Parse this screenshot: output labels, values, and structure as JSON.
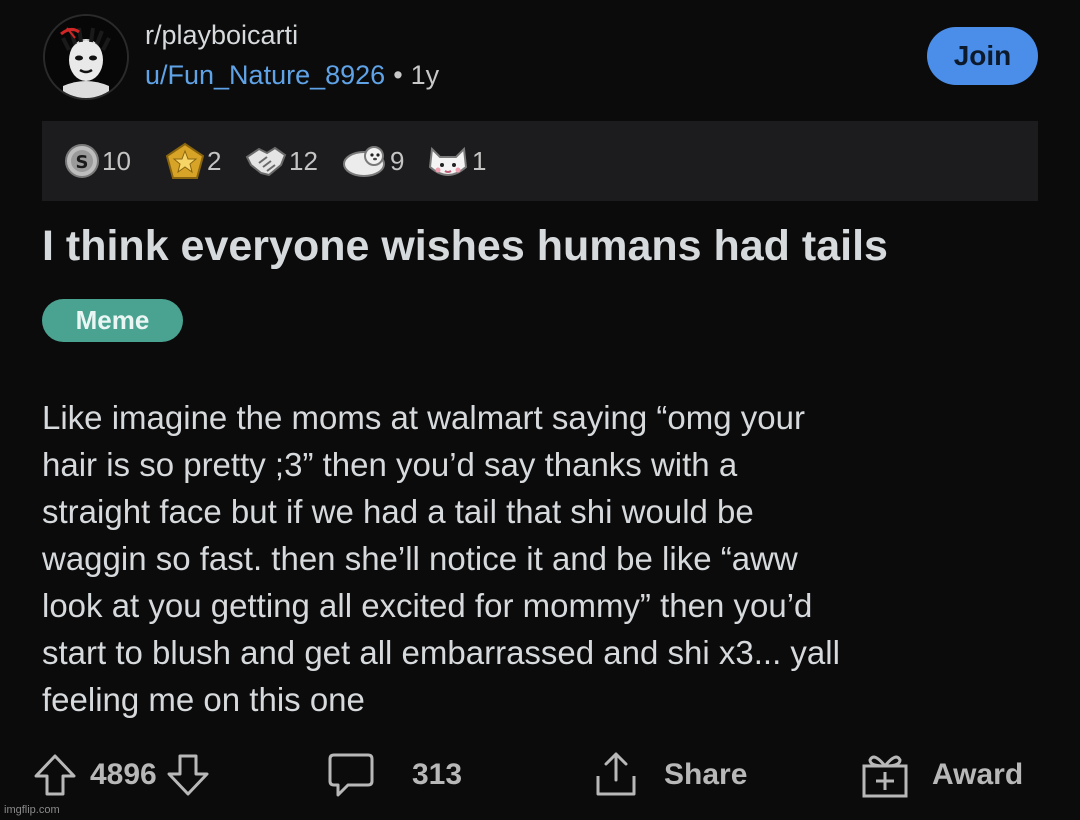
{
  "post": {
    "subreddit": "r/playboicarti",
    "username": "u/Fun_Nature_8926",
    "separator": "•",
    "age": "1y",
    "join_label": "Join",
    "title": "I think everyone wishes humans had tails",
    "flair": "Meme",
    "body_lines": [
      "Like imagine the moms at walmart saying “omg your",
      "hair is so pretty ;3” then you’d say thanks with a",
      "straight face but if we had a tail that shi would be",
      "waggin so fast. then she’ll notice it and be like “aww",
      "look at you getting all excited for mommy” then you’d",
      "start to blush and get all embarrassed and shi x3... yall",
      "feeling me on this one"
    ]
  },
  "awards": [
    {
      "icon": "silver-coin-icon",
      "count": "10"
    },
    {
      "icon": "gold-star-icon",
      "count": "2"
    },
    {
      "icon": "handshake-icon",
      "count": "12"
    },
    {
      "icon": "seal-icon",
      "count": "9"
    },
    {
      "icon": "cat-face-icon",
      "count": "1"
    }
  ],
  "actions": {
    "score": "4896",
    "comments": "313",
    "share_label": "Share",
    "award_label": "Award"
  },
  "watermark": "imgflip.com",
  "colors": {
    "background": "#0b0b0c",
    "link_blue": "#5fa3e6",
    "join_button": "#4a8ee9",
    "flair": "#4aa391",
    "awards_bar": "#1c1c1e"
  }
}
